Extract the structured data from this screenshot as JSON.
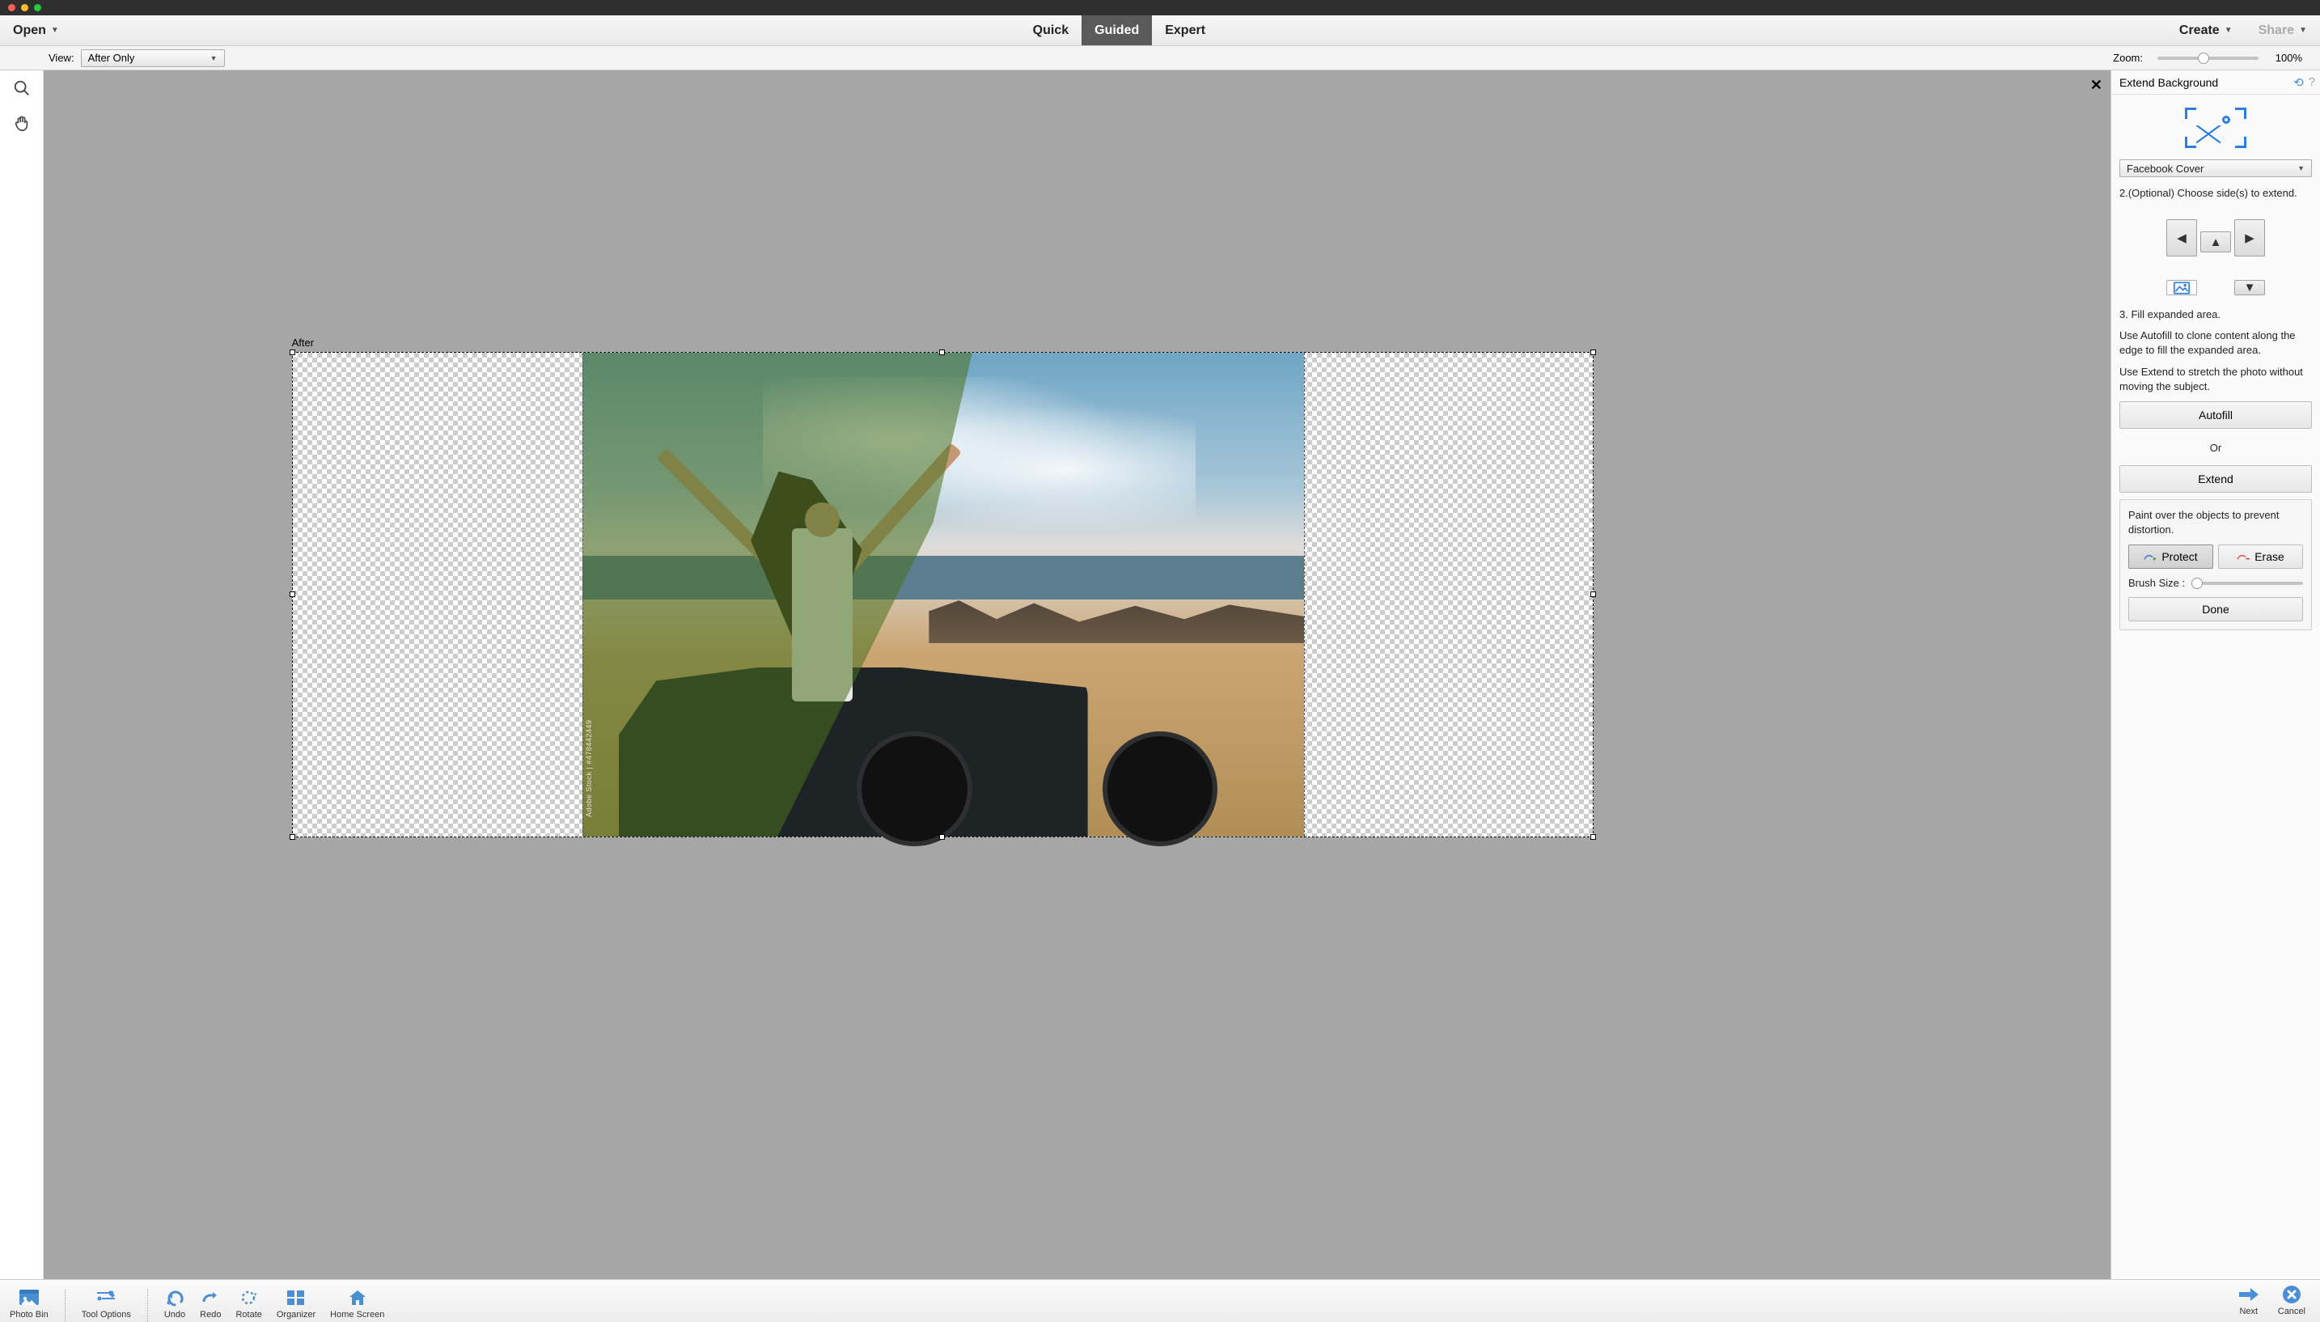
{
  "menubar": {
    "open": "Open",
    "quick": "Quick",
    "guided": "Guided",
    "expert": "Expert",
    "create": "Create",
    "share": "Share"
  },
  "optbar": {
    "view_label": "View:",
    "view_value": "After Only",
    "zoom_label": "Zoom:",
    "zoom_value": "100%"
  },
  "canvas": {
    "label": "After",
    "watermark": "Adobe Stock | #478442449"
  },
  "panel": {
    "title": "Extend Background",
    "preset": "Facebook Cover",
    "step2": "2.(Optional) Choose side(s) to extend.",
    "step3": "3. Fill expanded area.",
    "desc_autofill": "Use Autofill to clone content along the edge to fill the expanded area.",
    "desc_extend": "Use Extend to stretch the photo without moving the subject.",
    "btn_autofill": "Autofill",
    "or": "Or",
    "btn_extend": "Extend",
    "sub_desc": "Paint over the objects to prevent distortion.",
    "btn_protect": "Protect",
    "btn_erase": "Erase",
    "brush_label": "Brush Size :",
    "btn_done": "Done"
  },
  "bottombar": {
    "photo_bin": "Photo Bin",
    "tool_options": "Tool Options",
    "undo": "Undo",
    "redo": "Redo",
    "rotate": "Rotate",
    "organizer": "Organizer",
    "home_screen": "Home Screen",
    "next": "Next",
    "cancel": "Cancel"
  }
}
